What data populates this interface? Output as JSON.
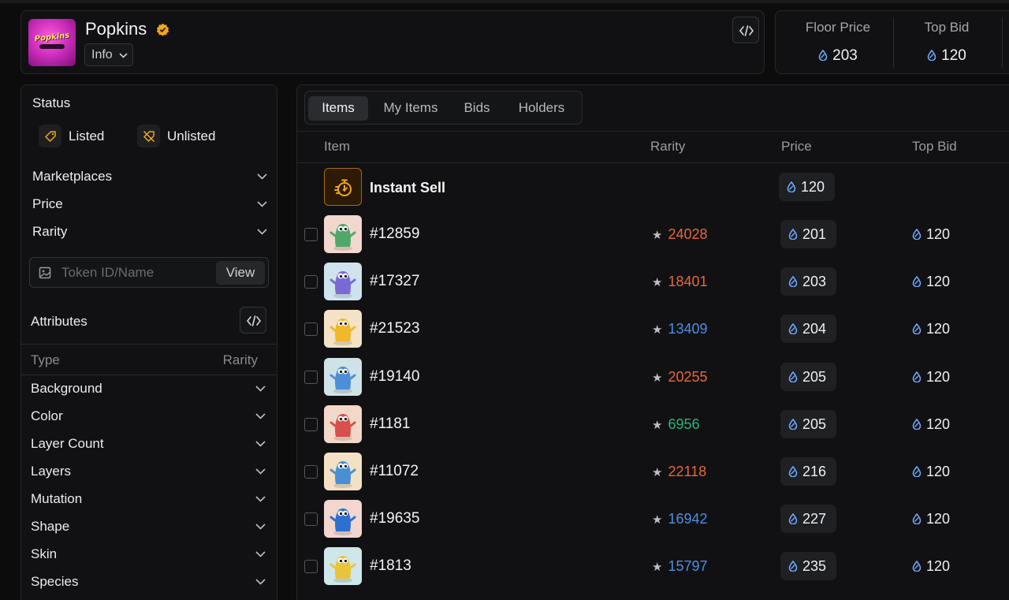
{
  "collection": {
    "name": "Popkins",
    "logo_text": "Popkins",
    "info_label": "Info"
  },
  "stats": {
    "floor_label": "Floor Price",
    "floor_value": "203",
    "topbid_label": "Top Bid",
    "topbid_value": "120"
  },
  "sidebar": {
    "status_title": "Status",
    "status_items": [
      {
        "label": "Listed",
        "icon": "tag-icon"
      },
      {
        "label": "Unlisted",
        "icon": "tag-off-icon"
      }
    ],
    "filters": [
      "Marketplaces",
      "Price",
      "Rarity"
    ],
    "search": {
      "placeholder": "Token ID/Name",
      "value": "",
      "button": "View"
    },
    "attributes_title": "Attributes",
    "attr_columns": {
      "type": "Type",
      "rarity": "Rarity"
    },
    "attributes": [
      "Background",
      "Color",
      "Layer Count",
      "Layers",
      "Mutation",
      "Shape",
      "Skin",
      "Species"
    ]
  },
  "tabs": [
    {
      "label": "Items",
      "active": true
    },
    {
      "label": "My Items",
      "active": false
    },
    {
      "label": "Bids",
      "active": false
    },
    {
      "label": "Holders",
      "active": false
    }
  ],
  "columns": {
    "item": "Item",
    "rarity": "Rarity",
    "price": "Price",
    "top_bid": "Top Bid"
  },
  "instant_sell": {
    "label": "Instant Sell",
    "price": "120"
  },
  "items": [
    {
      "name": "#12859",
      "rarity": "24028",
      "rarity_color": "#e8673a",
      "price": "201",
      "top_bid": "120",
      "creature_color": "#4fa86a",
      "bg_color": "#f2d7cf"
    },
    {
      "name": "#17327",
      "rarity": "18401",
      "rarity_color": "#e8673a",
      "price": "203",
      "top_bid": "120",
      "creature_color": "#7a6ad6",
      "bg_color": "#cfe3ee"
    },
    {
      "name": "#21523",
      "rarity": "13409",
      "rarity_color": "#4f8fe0",
      "price": "204",
      "top_bid": "120",
      "creature_color": "#f0b82a",
      "bg_color": "#f3e2c4"
    },
    {
      "name": "#19140",
      "rarity": "20255",
      "rarity_color": "#e8673a",
      "price": "205",
      "top_bid": "120",
      "creature_color": "#4c8fd8",
      "bg_color": "#cfe2e8"
    },
    {
      "name": "#1181",
      "rarity": "6956",
      "rarity_color": "#2fb37a",
      "price": "205",
      "top_bid": "120",
      "creature_color": "#d8504a",
      "bg_color": "#f2d8c8"
    },
    {
      "name": "#11072",
      "rarity": "22118",
      "rarity_color": "#e8673a",
      "price": "216",
      "top_bid": "120",
      "creature_color": "#4a8fd0",
      "bg_color": "#f3e1c6"
    },
    {
      "name": "#19635",
      "rarity": "16942",
      "rarity_color": "#4f8fe0",
      "price": "227",
      "top_bid": "120",
      "creature_color": "#2f6fd0",
      "bg_color": "#f2d6cf"
    },
    {
      "name": "#1813",
      "rarity": "15797",
      "rarity_color": "#4f8fe0",
      "price": "235",
      "top_bid": "120",
      "creature_color": "#e8c43a",
      "bg_color": "#cfe6ea"
    }
  ]
}
